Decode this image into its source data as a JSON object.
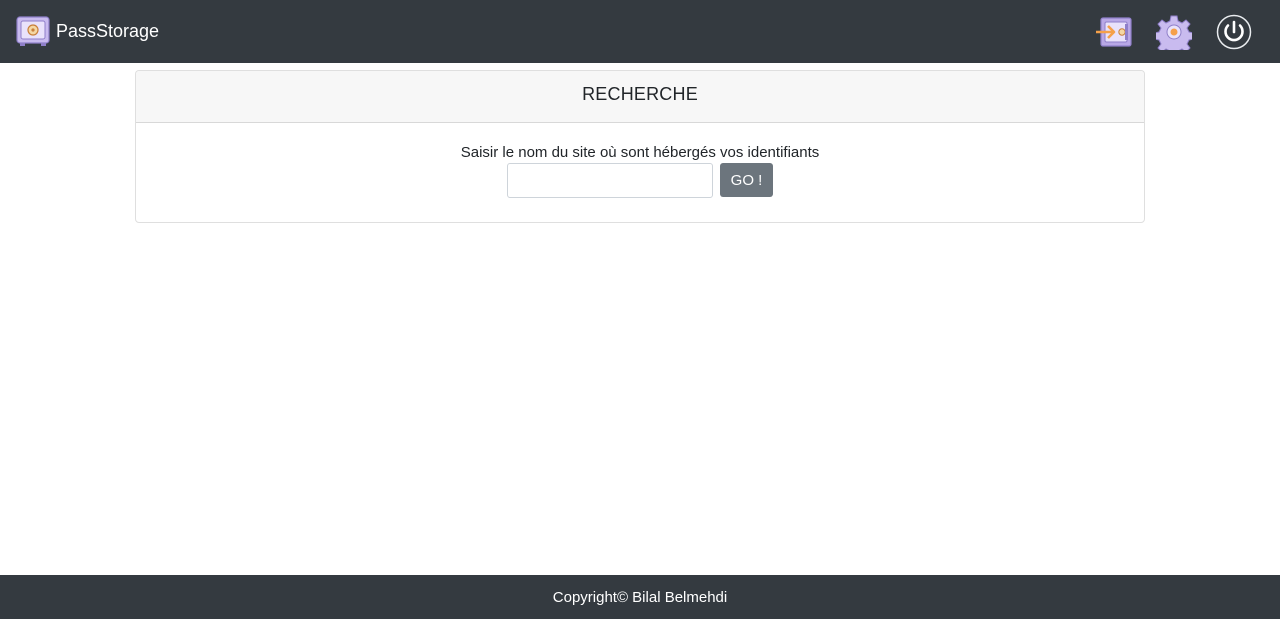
{
  "navbar": {
    "brand_name": "PassStorage",
    "icons": {
      "logo": "safe-icon",
      "vault": "vault-login-icon",
      "settings": "gear-icon",
      "logout": "power-icon"
    }
  },
  "search_card": {
    "header": "RECHERCHE",
    "hint": "Saisir le nom du site où sont hébergés vos identifiants",
    "input_value": "",
    "input_placeholder": "",
    "go_label": "GO !"
  },
  "footer": {
    "text": "Copyright© Bilal Belmehdi"
  },
  "colors": {
    "navbar_bg": "#343a40",
    "button_bg": "#6c757d",
    "header_bg": "#f7f7f7",
    "icon_purple": "#b9a8e6",
    "icon_orange": "#f5a04a"
  }
}
